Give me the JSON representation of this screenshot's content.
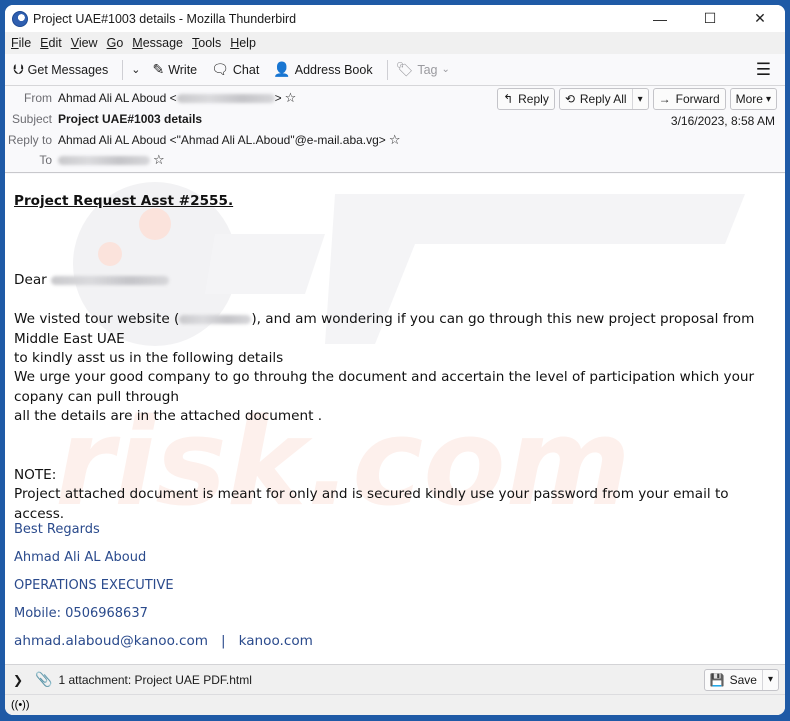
{
  "window": {
    "title": "Project UAE#1003 details - Mozilla Thunderbird",
    "controls": {
      "minimize": "—",
      "maximize": "☐",
      "close": "✕"
    }
  },
  "menubar": [
    {
      "label": "File",
      "accel": "F",
      "rest": "ile"
    },
    {
      "label": "Edit",
      "accel": "E",
      "rest": "dit"
    },
    {
      "label": "View",
      "accel": "V",
      "rest": "iew"
    },
    {
      "label": "Go",
      "accel": "G",
      "rest": "o"
    },
    {
      "label": "Message",
      "accel": "M",
      "rest": "essage"
    },
    {
      "label": "Tools",
      "accel": "T",
      "rest": "ools"
    },
    {
      "label": "Help",
      "accel": "H",
      "rest": "elp"
    }
  ],
  "toolbar": {
    "get_messages": "Get Messages",
    "write": "Write",
    "chat": "Chat",
    "address_book": "Address Book",
    "tag": "Tag",
    "icons": {
      "get_messages": "⮋",
      "write": "✎",
      "chat": "🗨",
      "address_book": "👤",
      "tag": "🏷",
      "menu": "☰",
      "dropdown": "⌄"
    }
  },
  "header": {
    "labels": {
      "from": "From",
      "subject": "Subject",
      "reply_to": "Reply to",
      "to": "To"
    },
    "from_name": "Ahmad Ali AL Aboud",
    "subject": "Project UAE#1003 details",
    "reply_to": "Ahmad Ali AL Aboud <\"Ahmad Ali AL.Aboud\"@e-mail.aba.vg>",
    "date": "3/16/2023, 8:58 AM",
    "buttons": {
      "reply": "Reply",
      "reply_all": "Reply All",
      "forward": "Forward",
      "more": "More"
    },
    "star": "☆"
  },
  "body": {
    "title": "Project Request Asst #2555.",
    "greeting": "Dear",
    "p1_before": "We visted tour website (",
    "p1_after": "), and am wondering if you can go through this new project proposal from Middle East UAE",
    "p2": "to kindly asst us in the following details",
    "p3": "We urge your good company to go throuhg the document and accertain the level of participation which your copany can pull through",
    "p4": "all the details are in the attached document .",
    "note_label": "NOTE:",
    "note": "Project attached document is meant for only and is secured kindly use your password from your email to access.",
    "signature": {
      "regards": "Best Regards",
      "name": "Ahmad Ali AL Aboud",
      "title": "OPERATIONS EXECUTIVE",
      "mobile": "Mobile: 0506968637",
      "email": "ahmad.alaboud@kanoo.com",
      "separator": "|",
      "website": "kanoo.com"
    }
  },
  "attachments": {
    "summary": "1 attachment: Project UAE PDF.html",
    "save": "Save"
  },
  "colors": {
    "frame": "#1f5aa6",
    "signature": "#2a4a8c"
  }
}
